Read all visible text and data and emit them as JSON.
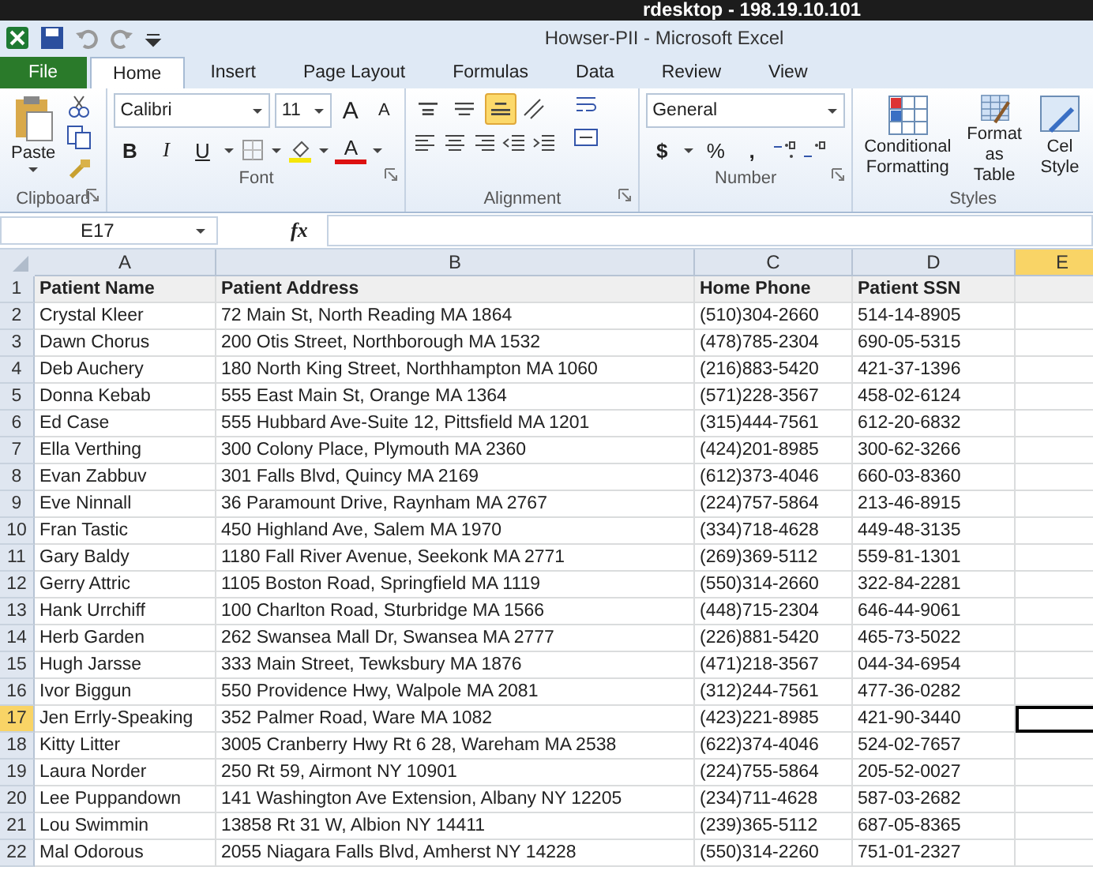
{
  "remote_title": "rdesktop - 198.19.10.101",
  "window": {
    "title": "Howser-PII -  Microsoft Excel"
  },
  "tabs": [
    {
      "label": "File",
      "kind": "file",
      "selected": false
    },
    {
      "label": "Home",
      "kind": "tab",
      "selected": true
    },
    {
      "label": "Insert",
      "kind": "tab",
      "selected": false
    },
    {
      "label": "Page Layout",
      "kind": "tab",
      "selected": false
    },
    {
      "label": "Formulas",
      "kind": "tab",
      "selected": false
    },
    {
      "label": "Data",
      "kind": "tab",
      "selected": false
    },
    {
      "label": "Review",
      "kind": "tab",
      "selected": false
    },
    {
      "label": "View",
      "kind": "tab",
      "selected": false
    }
  ],
  "ribbon": {
    "paste_label": "Paste",
    "font_name": "Calibri",
    "font_size": "11",
    "grow_font": "A",
    "shrink_font": "A",
    "style_buttons": [
      {
        "label": "B",
        "kind": "bold"
      },
      {
        "label": "I",
        "kind": "italic"
      },
      {
        "label": "U",
        "kind": "underline"
      }
    ],
    "font_color": "A",
    "vertical_align": [
      {
        "kind": "top",
        "on": false
      },
      {
        "kind": "middle",
        "on": false
      },
      {
        "kind": "bottom",
        "on": true
      }
    ],
    "number_format": "General",
    "currency": "$",
    "percent": "%",
    "comma": ",",
    "styles": [
      {
        "lines": [
          "Conditional",
          "Formatting"
        ],
        "kind": "conditional"
      },
      {
        "lines": [
          "Format",
          "as Table"
        ],
        "kind": "table"
      },
      {
        "lines": [
          "Cel",
          "Style"
        ],
        "kind": "cell"
      }
    ],
    "groups": [
      {
        "label": "Clipboard",
        "launcher": true
      },
      {
        "label": "Font",
        "launcher": true
      },
      {
        "label": "Alignment",
        "launcher": true
      },
      {
        "label": "Number",
        "launcher": true
      },
      {
        "label": "Styles",
        "launcher": false
      }
    ]
  },
  "formula_bar": {
    "name_box": "E17",
    "function_label": "fx"
  },
  "sheet": {
    "columns": [
      {
        "label": "A",
        "selected": false
      },
      {
        "label": "B",
        "selected": false
      },
      {
        "label": "C",
        "selected": false
      },
      {
        "label": "D",
        "selected": false
      },
      {
        "label": "E",
        "selected": true
      }
    ],
    "rows": [
      {
        "number": "1",
        "kind": "header",
        "selected": false,
        "cells": [
          "Patient Name",
          "Patient Address",
          "Home Phone",
          "Patient SSN"
        ]
      },
      {
        "number": "2",
        "kind": "data",
        "selected": false,
        "cells": [
          "Crystal Kleer",
          "72 Main St, North Reading MA 1864",
          "(510)304-2660",
          "514-14-8905"
        ]
      },
      {
        "number": "3",
        "kind": "data",
        "selected": false,
        "cells": [
          "Dawn Chorus",
          "200 Otis Street, Northborough MA 1532",
          "(478)785-2304",
          "690-05-5315"
        ]
      },
      {
        "number": "4",
        "kind": "data",
        "selected": false,
        "cells": [
          "Deb Auchery",
          "180 North King Street, Northhampton MA 1060",
          "(216)883-5420",
          "421-37-1396"
        ]
      },
      {
        "number": "5",
        "kind": "data",
        "selected": false,
        "cells": [
          "Donna Kebab",
          "555 East Main St, Orange MA 1364",
          "(571)228-3567",
          "458-02-6124"
        ]
      },
      {
        "number": "6",
        "kind": "data",
        "selected": false,
        "cells": [
          "Ed Case",
          "555 Hubbard Ave-Suite 12, Pittsfield MA 1201",
          "(315)444-7561",
          "612-20-6832"
        ]
      },
      {
        "number": "7",
        "kind": "data",
        "selected": false,
        "cells": [
          "Ella Verthing",
          "300 Colony Place, Plymouth MA 2360",
          "(424)201-8985",
          "300-62-3266"
        ]
      },
      {
        "number": "8",
        "kind": "data",
        "selected": false,
        "cells": [
          "Evan Zabbuv",
          "301 Falls Blvd, Quincy MA 2169",
          "(612)373-4046",
          "660-03-8360"
        ]
      },
      {
        "number": "9",
        "kind": "data",
        "selected": false,
        "cells": [
          "Eve Ninnall",
          "36 Paramount Drive, Raynham MA 2767",
          "(224)757-5864",
          "213-46-8915"
        ]
      },
      {
        "number": "10",
        "kind": "data",
        "selected": false,
        "cells": [
          "Fran Tastic",
          "450 Highland Ave, Salem MA 1970",
          "(334)718-4628",
          "449-48-3135"
        ]
      },
      {
        "number": "11",
        "kind": "data",
        "selected": false,
        "cells": [
          "Gary Baldy",
          "1180 Fall River Avenue, Seekonk MA 2771",
          "(269)369-5112",
          "559-81-1301"
        ]
      },
      {
        "number": "12",
        "kind": "data",
        "selected": false,
        "cells": [
          "Gerry Attric",
          "1105 Boston Road, Springfield MA 1119",
          "(550)314-2660",
          "322-84-2281"
        ]
      },
      {
        "number": "13",
        "kind": "data",
        "selected": false,
        "cells": [
          "Hank Urrchiff",
          "100 Charlton Road, Sturbridge MA 1566",
          "(448)715-2304",
          "646-44-9061"
        ]
      },
      {
        "number": "14",
        "kind": "data",
        "selected": false,
        "cells": [
          "Herb Garden",
          "262 Swansea Mall Dr, Swansea MA 2777",
          "(226)881-5420",
          "465-73-5022"
        ]
      },
      {
        "number": "15",
        "kind": "data",
        "selected": false,
        "cells": [
          "Hugh Jarsse",
          "333 Main Street, Tewksbury MA 1876",
          "(471)218-3567",
          "044-34-6954"
        ]
      },
      {
        "number": "16",
        "kind": "data",
        "selected": false,
        "cells": [
          "Ivor Biggun",
          "550 Providence Hwy, Walpole MA 2081",
          "(312)244-7561",
          "477-36-0282"
        ]
      },
      {
        "number": "17",
        "kind": "data",
        "selected": true,
        "cells": [
          "Jen Errly-Speaking",
          "352 Palmer Road, Ware MA 1082",
          "(423)221-8985",
          "421-90-3440"
        ]
      },
      {
        "number": "18",
        "kind": "data",
        "selected": false,
        "cells": [
          "Kitty Litter",
          "3005 Cranberry Hwy Rt 6 28, Wareham MA 2538",
          "(622)374-4046",
          "524-02-7657"
        ]
      },
      {
        "number": "19",
        "kind": "data",
        "selected": false,
        "cells": [
          "Laura Norder",
          "250 Rt 59, Airmont NY 10901",
          "(224)755-5864",
          "205-52-0027"
        ]
      },
      {
        "number": "20",
        "kind": "data",
        "selected": false,
        "cells": [
          "Lee Puppandown",
          "141 Washington Ave Extension, Albany NY 12205",
          "(234)711-4628",
          "587-03-2682"
        ]
      },
      {
        "number": "21",
        "kind": "data",
        "selected": false,
        "cells": [
          "Lou Swimmin",
          "13858 Rt 31 W, Albion NY 14411",
          "(239)365-5112",
          "687-05-8365"
        ]
      },
      {
        "number": "22",
        "kind": "data",
        "selected": false,
        "cells": [
          "Mal Odorous",
          "2055 Niagara Falls Blvd, Amherst NY 14228",
          "(550)314-2260",
          "751-01-2327"
        ]
      }
    ]
  }
}
